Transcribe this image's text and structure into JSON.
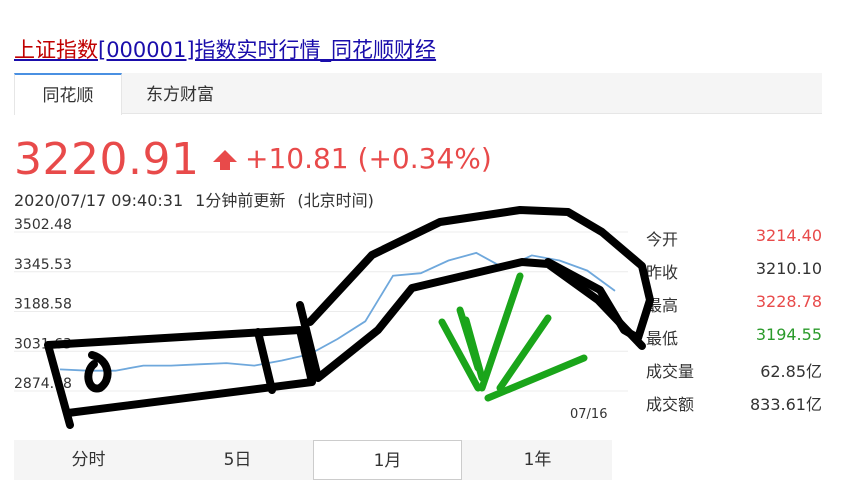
{
  "page": {
    "title_highlight": "上证指数",
    "title_rest": "[000001]指数实时行情_同花顺财经"
  },
  "tabs": [
    {
      "label": "同花顺",
      "active": true
    },
    {
      "label": "东方财富",
      "active": false
    }
  ],
  "quote": {
    "price": "3220.91",
    "change": "+10.81",
    "change_pct": "(+0.34%)",
    "datetime": "2020/07/17 09:40:31",
    "update_note": "1分钟前更新",
    "timezone_note": "(北京时间)",
    "up_color": "#e84a4a",
    "down_color": "#2a9a2a"
  },
  "stats": [
    {
      "label": "今开",
      "value": "3214.40",
      "color": "#e84a4a"
    },
    {
      "label": "昨收",
      "value": "3210.10",
      "color": "#333333"
    },
    {
      "label": "最高",
      "value": "3228.78",
      "color": "#e84a4a"
    },
    {
      "label": "最低",
      "value": "3194.55",
      "color": "#2a9a2a"
    },
    {
      "label": "成交量",
      "value": "62.85亿",
      "color": "#333333"
    },
    {
      "label": "成交额",
      "value": "833.61亿",
      "color": "#333333"
    }
  ],
  "periods": [
    {
      "label": "分时",
      "active": false
    },
    {
      "label": "5日",
      "active": false
    },
    {
      "label": "1月",
      "active": true
    },
    {
      "label": "1年",
      "active": false
    }
  ],
  "chart_data": {
    "type": "line",
    "y_ticks": [
      "3502.48",
      "3345.53",
      "3188.58",
      "3031.63",
      "2874.68"
    ],
    "ylim": [
      2874.68,
      3502.48
    ],
    "x_tick": "07/16",
    "grid": true,
    "series": [
      {
        "color": "#6fa8dc",
        "values": [
          2960,
          2955,
          2955,
          2975,
          2975,
          2980,
          2985,
          2975,
          2995,
          3020,
          3080,
          3150,
          3330,
          3340,
          3390,
          3420,
          3360,
          3410,
          3390,
          3350,
          3270
        ]
      }
    ]
  },
  "annotations": {
    "scribble_note": "hand-drawn black scribble (knife shape) and green strokes over chart"
  }
}
